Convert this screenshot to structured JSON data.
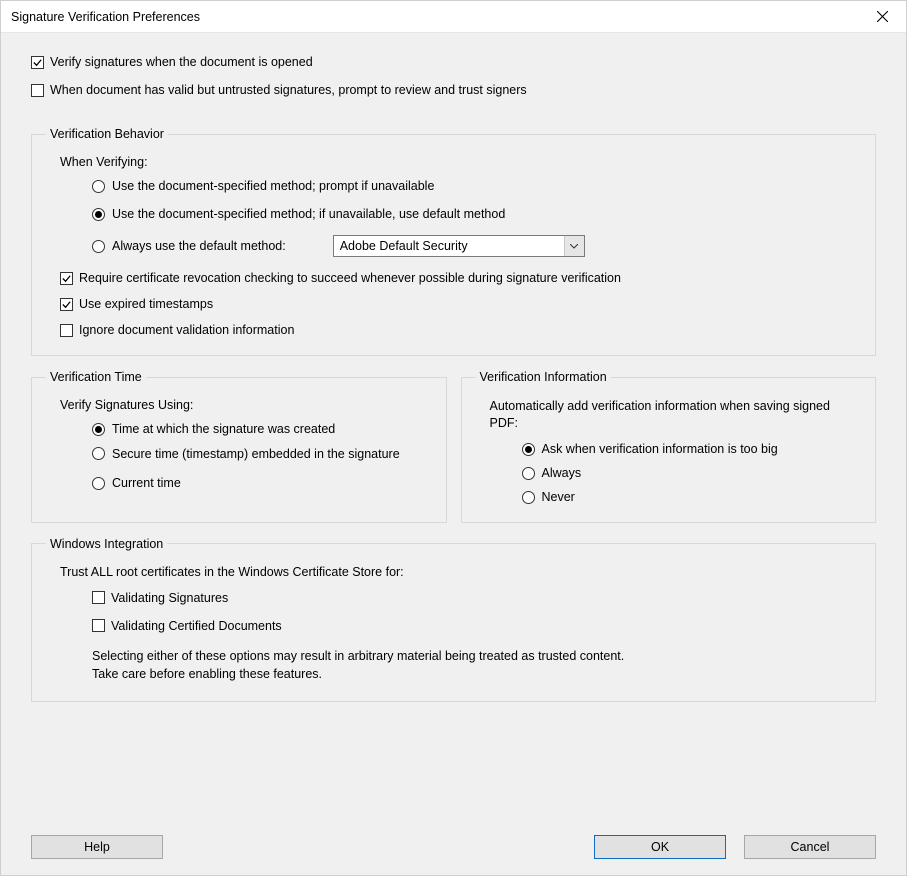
{
  "title": "Signature Verification Preferences",
  "top": {
    "verify_on_open": "Verify signatures when the document is opened",
    "prompt_untrusted": "When document has valid but untrusted signatures, prompt to review and trust signers"
  },
  "behavior": {
    "legend": "Verification Behavior",
    "when": "When Verifying:",
    "r1": "Use the document-specified method; prompt if unavailable",
    "r2": "Use the document-specified method; if unavailable, use default method",
    "r3": "Always use the default method:",
    "select": "Adobe Default Security",
    "revocation": "Require certificate revocation checking to succeed whenever possible during signature verification",
    "expired": "Use expired timestamps",
    "ignore": "Ignore document validation information"
  },
  "time": {
    "legend": "Verification Time",
    "sub": "Verify Signatures Using:",
    "r1": "Time at which the signature was created",
    "r2": "Secure time (timestamp) embedded in the signature",
    "r3": "Current time"
  },
  "info": {
    "legend": "Verification Information",
    "sub": "Automatically add verification information when saving signed PDF:",
    "r1": "Ask when verification information is too big",
    "r2": "Always",
    "r3": "Never"
  },
  "win": {
    "legend": "Windows Integration",
    "sub": "Trust ALL root certificates in the Windows Certificate Store for:",
    "c1": "Validating Signatures",
    "c2": "Validating Certified Documents",
    "note1": "Selecting either of these options may result in arbitrary material being treated as trusted content.",
    "note2": "Take care before enabling these features."
  },
  "buttons": {
    "help": "Help",
    "ok": "OK",
    "cancel": "Cancel"
  }
}
